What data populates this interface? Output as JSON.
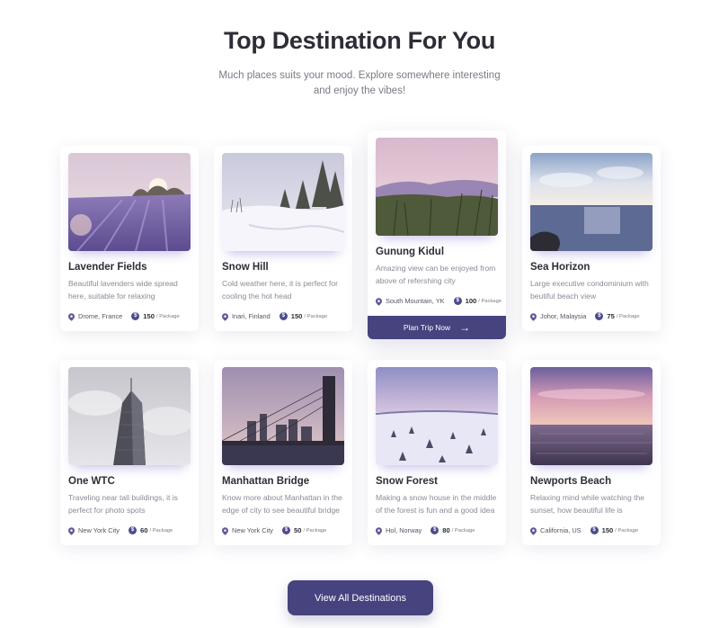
{
  "header": {
    "title": "Top Destination For You",
    "subtitle": "Much places suits your mood. Explore somewhere interesting and enjoy the vibes!"
  },
  "per_label": "/ Package",
  "plan_label": "Plan Trip Now",
  "view_all_label": "View All Destinations",
  "colors": {
    "accent": "#46437f",
    "coin": "#4e4b8c",
    "pin": "#5d5a9a"
  },
  "destinations": [
    {
      "name": "Lavender Fields",
      "desc": "Beautiful lavenders wide spread here, suitable for relaxing",
      "location": "Drome, France",
      "price": "150",
      "image": "lavender-field-photo"
    },
    {
      "name": "Snow Hill",
      "desc": "Cold weather here, it is perfect for cooling the hot head",
      "location": "Inari, Finland",
      "price": "150",
      "image": "snowy-hill-photo"
    },
    {
      "name": "Gunung Kidul",
      "desc": "Amazing view can be enjoyed from above of refershing city",
      "location": "South Mountain, YK",
      "price": "100",
      "image": "mountain-meadow-photo"
    },
    {
      "name": "Sea Horizon",
      "desc": "Large executive condominium with beutiful beach view",
      "location": "Johor, Malaysia",
      "price": "75",
      "image": "sea-horizon-photo"
    },
    {
      "name": "One WTC",
      "desc": "Traveling near tall buildings, it is perfect for photo spots",
      "location": "New York City",
      "price": "60",
      "image": "skyscraper-photo"
    },
    {
      "name": "Manhattan Bridge",
      "desc": "Know more about Manhattan in the edge of city to see beautiful bridge",
      "location": "New York City",
      "price": "50",
      "image": "bridge-city-photo"
    },
    {
      "name": "Snow Forest",
      "desc": "Making a snow house in the middle of the forest is fun and a good idea",
      "location": "Hol, Norway",
      "price": "80",
      "image": "snow-forest-photo"
    },
    {
      "name": "Newports Beach",
      "desc": "Relaxing mind while watching the sunset, how beautiful life is",
      "location": "California, US",
      "price": "150",
      "image": "sunset-beach-photo"
    }
  ]
}
